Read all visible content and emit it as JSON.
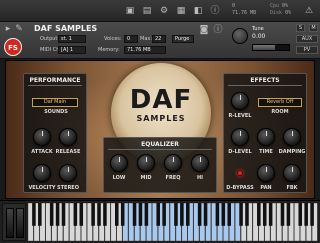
{
  "toolbar": {
    "readout_value_1": "0",
    "readout_value_2": "71.76 MB",
    "cpu_label": "Cpu",
    "cpu_value": "0%",
    "disk_label": "Disk",
    "disk_value": "0%"
  },
  "header": {
    "instrument_name": "DAF SAMPLES",
    "output_label": "Output:",
    "output_value": "st. 1",
    "voices_label": "Voices:",
    "voices_value": "0",
    "max_label": "Max:",
    "max_value": "22",
    "purge_label": "Purge",
    "midi_label": "MIDI Ch:",
    "midi_value": "[A] 1",
    "memory_label": "Memory:",
    "memory_value": "71.76 MB",
    "tune_label": "Tune",
    "tune_value": "0.00",
    "volume_level": 0.6,
    "s_button": "S",
    "m_button": "M",
    "aux_button": "AUX",
    "pv_button": "PV",
    "logo_text": "FS"
  },
  "panel": {
    "title_main": "DAF",
    "title_sub": "SAMPLES",
    "performance": {
      "title": "PERFORMANCE",
      "sound_value": "Daf Main",
      "sounds_label": "SOUNDS",
      "attack_label": "ATTACK",
      "release_label": "RELEASE",
      "velocity_label": "VELOCITY",
      "stereo_label": "STEREO"
    },
    "equalizer": {
      "title": "EQUALIZER",
      "low_label": "LOW",
      "mid_label": "MID",
      "freq_label": "FREQ",
      "hi_label": "HI"
    },
    "effects": {
      "title": "EFFECTS",
      "reverb_value": "Reverb Off",
      "room_label": "ROOM",
      "rlevel_label": "R-LEVEL",
      "dlevel_label": "D-LEVEL",
      "time_label": "TIME",
      "damping_label": "DAMPING",
      "dbypass_label": "D-BYPASS",
      "pan_label": "PAN",
      "fbk_label": "FBK"
    }
  },
  "colors": {
    "accent": "#e8c26a",
    "led": "#e12222",
    "active_keys": "#a8c8ee",
    "logo": "#d0281e"
  }
}
